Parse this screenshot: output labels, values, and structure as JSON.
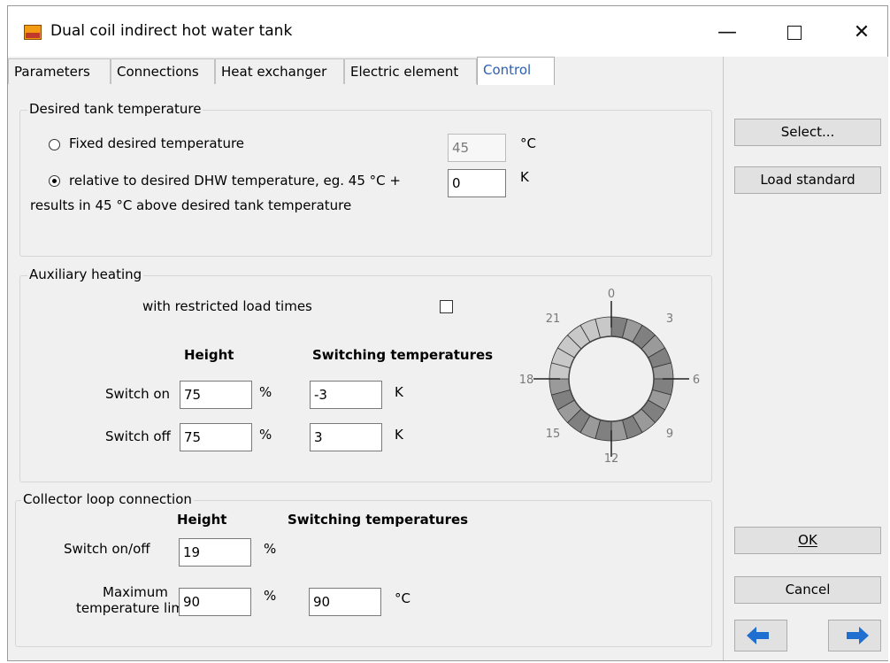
{
  "window": {
    "title": "Dual coil indirect hot water tank",
    "minimize_glyph": "—",
    "close_glyph": "✕",
    "icon": "app-icon"
  },
  "tabs": [
    {
      "label": "Parameters",
      "active": false
    },
    {
      "label": "Connections",
      "active": false
    },
    {
      "label": "Heat exchanger",
      "active": false
    },
    {
      "label": "Electric element",
      "active": false
    },
    {
      "label": "Control",
      "active": true
    }
  ],
  "desired_tank": {
    "title": "Desired tank temperature",
    "fixed_label": "Fixed desired temperature",
    "fixed_value": "45",
    "fixed_unit": "°C",
    "relative_label_1": "relative to desired DHW temperature, eg. 45 °C +",
    "relative_label_2": "results in 45 °C above desired tank temperature",
    "relative_value": "0",
    "relative_unit": "K",
    "selected": "relative"
  },
  "auxiliary": {
    "title": "Auxiliary heating",
    "restricted_label": "with restricted load times",
    "restricted_checked": false,
    "height_header": "Height",
    "switching_header": "Switching temperatures",
    "switch_on_label": "Switch on",
    "switch_on_height": "75",
    "switch_on_temp": "-3",
    "switch_off_label": "Switch off",
    "switch_off_height": "75",
    "switch_off_temp": "3",
    "percent_unit": "%",
    "kelvin_unit": "K",
    "clock_labels": [
      "0",
      "3",
      "6",
      "9",
      "12",
      "15",
      "18",
      "21"
    ]
  },
  "collector": {
    "title": "Collector loop connection",
    "height_header": "Height",
    "switching_header": "Switching temperatures",
    "switch_label": "Switch on/off",
    "switch_value": "19",
    "max_label_1": "Maximum",
    "max_label_2": "temperature limit",
    "max_height": "90",
    "max_temp": "90",
    "percent_unit": "%",
    "celsius_unit": "°C"
  },
  "side_buttons": {
    "select": "Select...",
    "load_standard": "Load standard",
    "ok": "OK",
    "cancel": "Cancel",
    "back_icon": "arrow-left-icon",
    "forward_icon": "arrow-right-icon"
  },
  "colors": {
    "active_tab": "#2b5fb5",
    "arrow_blue": "#1e6fd0",
    "clock_light": "#c8c8c8",
    "clock_dark": "#808080"
  }
}
